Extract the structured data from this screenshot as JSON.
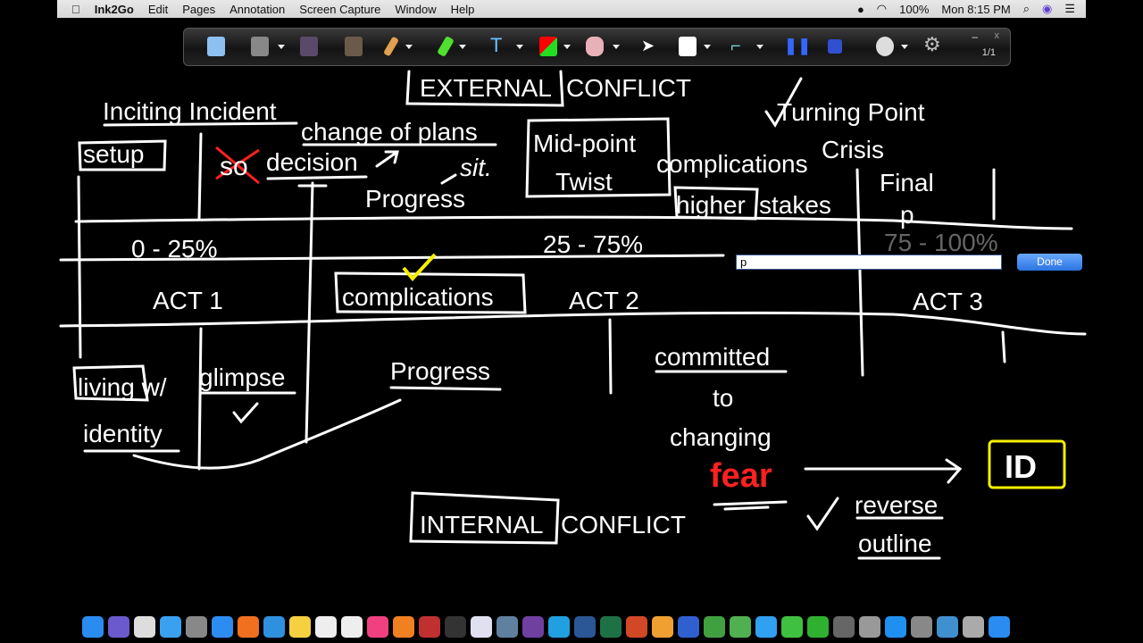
{
  "menubar": {
    "app": "Ink2Go",
    "items": [
      "Edit",
      "Pages",
      "Annotation",
      "Screen Capture",
      "Window",
      "Help"
    ],
    "battery": "100%",
    "clock": "Mon 8:15 PM"
  },
  "toolbar": {
    "tools": [
      "new-page-icon",
      "save-icon",
      "previous-page-icon",
      "next-page-icon",
      "pencil-icon",
      "highlighter-icon",
      "text-icon",
      "shape-icon",
      "eraser-icon",
      "pointer-icon",
      "background-icon",
      "line-tool-icon",
      "pause-icon",
      "stop-icon",
      "webcam-icon",
      "gear-icon"
    ],
    "page_count": "1/1",
    "minimize": "–",
    "close": "x"
  },
  "board": {
    "texts": {
      "external_conflict_a": "EXTERNAL",
      "external_conflict_b": "CONFLICT",
      "inciting_incident": "Inciting Incident",
      "change_of_plans": "change of plans",
      "setup": "setup",
      "crossed_out": "so",
      "decision": "decision",
      "progress_top": "Progress",
      "sit": "sit.",
      "midpoint": "Mid-point",
      "twist": "Twist",
      "complications_top": "complications",
      "higher": "higher",
      "stakes": "stakes",
      "turning_point": "Turning Point",
      "crisis": "Crisis",
      "final": "Final",
      "p": "p",
      "pct_act1": "0 - 25%",
      "pct_act2": "25 - 75%",
      "pct_act3": "75 - 100%",
      "complications_mid": "complications",
      "act1": "ACT 1",
      "act2": "ACT 2",
      "act3": "ACT 3",
      "living_w": "living w/",
      "identity": "identity",
      "glimpse": "glimpse",
      "progress_bottom": "Progress",
      "committed": "committed",
      "to": "to",
      "changing": "changing",
      "fear": "fear",
      "internal_a": "INTERNAL",
      "internal_b": "CONFLICT",
      "reverse": "reverse",
      "outline": "outline",
      "id": "ID"
    },
    "colors": {
      "ink": "#ffffff",
      "red": "#ff2020",
      "yellow": "#f5f000",
      "faded": "#666666"
    }
  },
  "text_entry": {
    "value": "p",
    "done_label": "Done"
  },
  "dock": {
    "apps": [
      "finder",
      "siri",
      "launchpad",
      "calendar",
      "app-store",
      "system-prefs",
      "safari",
      "firefox",
      "preview",
      "notes",
      "stickies",
      "textedit",
      "itunes",
      "ibooks",
      "scrobbles",
      "kindle",
      "photos",
      "network",
      "imovie",
      "mosaic",
      "skype",
      "word",
      "excel",
      "powerpoint",
      "pages",
      "keynote",
      "numbers",
      "maps",
      "messages",
      "facetime",
      "activity-monitor",
      "disk-utility",
      "app-store-2",
      "file-merge",
      "downloads",
      "trash"
    ]
  }
}
